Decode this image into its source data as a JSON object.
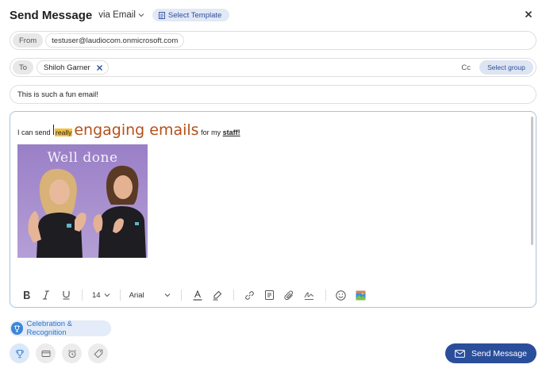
{
  "header": {
    "title": "Send Message",
    "channel": "via Email",
    "template_button": "Select Template",
    "close_icon": "close-icon"
  },
  "from": {
    "label": "From",
    "value": "testuser@laudiocom.onmicrosoft.com"
  },
  "to": {
    "label": "To",
    "recipients": [
      "Shiloh Garner"
    ],
    "cc_label": "Cc",
    "select_group": "Select group"
  },
  "subject": {
    "value": "This is such a fun email!"
  },
  "message": {
    "segments": {
      "part1": "I can send ",
      "highlighted": "really",
      "large": "engaging emails",
      "part2": " for my ",
      "bold_underline": "staff!"
    },
    "image_caption": "Well done"
  },
  "toolbar": {
    "font_size": "14",
    "font_family": "Arial",
    "icons": [
      "bold-icon",
      "italic-icon",
      "underline-icon",
      "font-color-icon",
      "highlight-icon",
      "link-icon",
      "document-icon",
      "attachment-icon",
      "signature-icon",
      "emoji-icon",
      "image-icon"
    ]
  },
  "category": {
    "label": "Celebration & Recognition",
    "icon": "trophy-icon"
  },
  "categories_bar": [
    "trophy-icon",
    "card-icon",
    "alarm-clock-icon",
    "tag-icon"
  ],
  "actions": {
    "send": "Send Message"
  },
  "colors": {
    "primary": "#2b4e9b",
    "highlight": "#f4c03d",
    "large_text": "#b5501a",
    "editor_border": "#a9c4dd"
  }
}
